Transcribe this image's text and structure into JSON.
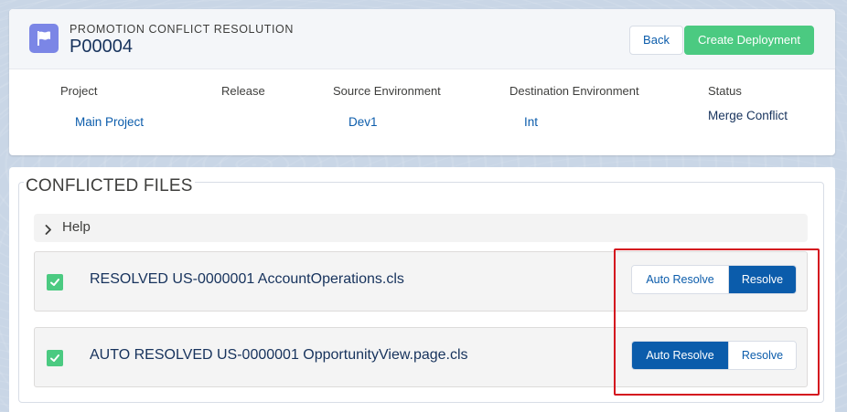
{
  "header": {
    "eyebrow": "PROMOTION CONFLICT RESOLUTION",
    "title": "P00004",
    "icon": "flag-icon",
    "back_label": "Back",
    "create_label": "Create Deployment"
  },
  "fields": {
    "project_label": "Project",
    "project_value": "Main Project",
    "release_label": "Release",
    "release_value": "",
    "source_label": "Source Environment",
    "source_value": "Dev1",
    "destination_label": "Destination Environment",
    "destination_value": "Int",
    "status_label": "Status",
    "status_value": "Merge Conflict"
  },
  "conflicts": {
    "heading": "CONFLICTED FILES",
    "help_label": "Help",
    "files": [
      {
        "label": "RESOLVED US-0000001 AccountOperations.cls",
        "auto_label": "Auto Resolve",
        "resolve_label": "Resolve",
        "selected": "resolve"
      },
      {
        "label": "AUTO RESOLVED US-0000001 OpportunityView.page.cls",
        "auto_label": "Auto Resolve",
        "resolve_label": "Resolve",
        "selected": "auto"
      }
    ]
  },
  "colors": {
    "brand_blue": "#0b5cab",
    "success_green": "#4bca81",
    "icon_purple": "#7b86e6",
    "highlight_red": "#d4121e"
  }
}
